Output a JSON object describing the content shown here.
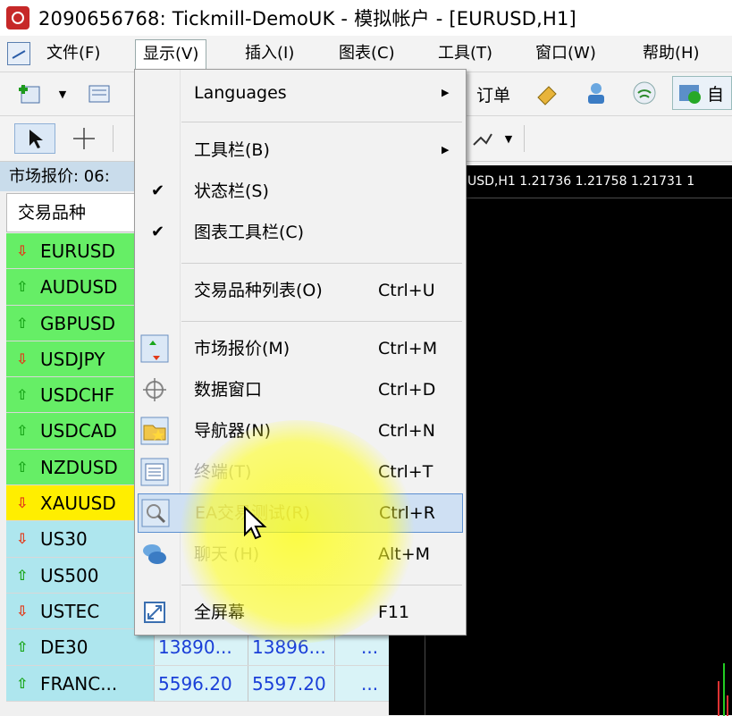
{
  "window": {
    "title": "2090656768: Tickmill-DemoUK - 模拟帐户 - [EURUSD,H1]"
  },
  "menubar": {
    "items": [
      "文件(F)",
      "显示(V)",
      "插入(I)",
      "图表(C)",
      "工具(T)",
      "窗口(W)",
      "帮助(H)"
    ],
    "active": "显示(V)"
  },
  "toolbar": {
    "new_order_label": "订单",
    "auto_label": "自"
  },
  "chart": {
    "info": "USD,H1  1.21736 1.21758 1.21731 1"
  },
  "market_watch": {
    "title": "市场报价: 06:",
    "column_symbol": "交易品种",
    "rows": [
      {
        "symbol": "EURUSD",
        "direction": "down",
        "bg": "#66ee66"
      },
      {
        "symbol": "AUDUSD",
        "direction": "up",
        "bg": "#66ee66"
      },
      {
        "symbol": "GBPUSD",
        "direction": "up",
        "bg": "#66ee66"
      },
      {
        "symbol": "USDJPY",
        "direction": "down",
        "bg": "#66ee66"
      },
      {
        "symbol": "USDCHF",
        "direction": "up",
        "bg": "#66ee66"
      },
      {
        "symbol": "USDCAD",
        "direction": "up",
        "bg": "#66ee66"
      },
      {
        "symbol": "NZDUSD",
        "direction": "up",
        "bg": "#66ee66"
      },
      {
        "symbol": "XAUUSD",
        "direction": "down",
        "bg": "#ffee00"
      },
      {
        "symbol": "US30",
        "direction": "down",
        "bg": "#aee6ee"
      },
      {
        "symbol": "US500",
        "direction": "up",
        "bg": "#aee6ee"
      },
      {
        "symbol": "USTEC",
        "direction": "down",
        "bg": "#aee6ee"
      },
      {
        "symbol": "DE30",
        "direction": "up",
        "bg": "#aee6ee",
        "bid": "13890...",
        "ask": "13896...",
        "more": "..."
      },
      {
        "symbol": "FRANC...",
        "direction": "up",
        "bg": "#aee6ee",
        "bid": "5596.20",
        "ask": "5597.20",
        "more": "..."
      }
    ]
  },
  "view_menu": {
    "items": [
      {
        "label": "Languages",
        "shortcut": "",
        "submenu": true
      },
      {
        "label": "工具栏(B)",
        "shortcut": "",
        "submenu": true
      },
      {
        "label": "状态栏(S)",
        "shortcut": "",
        "checked": true
      },
      {
        "label": "图表工具栏(C)",
        "shortcut": "",
        "checked": true
      },
      {
        "label": "交易品种列表(O)",
        "shortcut": "Ctrl+U"
      },
      {
        "label": "市场报价(M)",
        "shortcut": "Ctrl+M",
        "icon": "market-watch-icon"
      },
      {
        "label": "数据窗口",
        "shortcut": "Ctrl+D",
        "icon": "crosshair-icon"
      },
      {
        "label": "导航器(N)",
        "shortcut": "Ctrl+N",
        "icon": "navigator-folder-icon"
      },
      {
        "label": "终端(T)",
        "shortcut": "Ctrl+T",
        "icon": "terminal-icon"
      },
      {
        "label": "EA交易测试(R)",
        "shortcut": "Ctrl+R",
        "icon": "strategy-tester-icon",
        "highlighted": true
      },
      {
        "label": "聊天 (H)",
        "shortcut": "Alt+M",
        "icon": "chat-icon"
      },
      {
        "label": "全屏幕",
        "shortcut": "F11",
        "icon": "fullscreen-icon"
      }
    ]
  },
  "colors": {
    "up_arrow": "#1aa61a",
    "down_arrow": "#e23a1a",
    "price_text": "#1a3fd8",
    "highlight": "#cfe0f3"
  }
}
